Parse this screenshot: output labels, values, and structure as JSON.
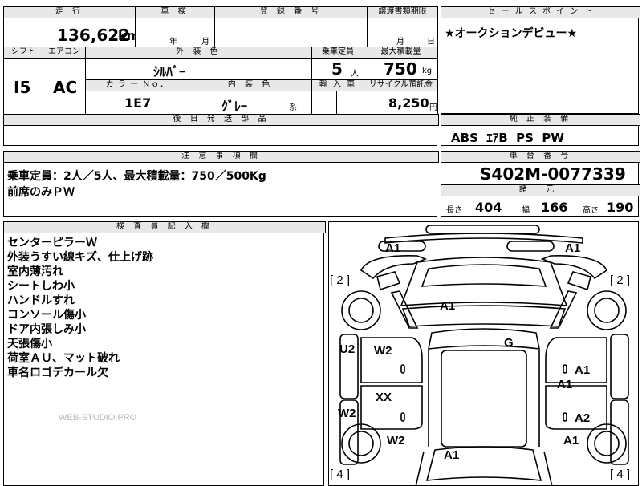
{
  "header_row": {
    "mileage_label": "走 行",
    "inspection_label": "車 検",
    "registration_label": "登 録 番 号",
    "transfer_label": "譲渡書類期限",
    "mileage_value": "136,622",
    "mileage_unit": "km",
    "year_label": "年",
    "month_label": "月",
    "transfer_month": "月",
    "transfer_day": "日"
  },
  "spec_row": {
    "shift_label": "シフト",
    "ac_label": "エアコン",
    "exterior_label": "外 装 色",
    "capacity_label": "乗車定員",
    "max_load_label": "最大積載量",
    "shift_value": "I5",
    "ac_value": "AC",
    "exterior_value": "ｼﾙﾊﾞｰ",
    "capacity_value": "5",
    "capacity_unit": "人",
    "max_load_value": "750",
    "max_load_unit": "kg",
    "color_no_label": "カ ラ ー Ｎｏ．",
    "interior_label": "内 装 色",
    "import_label": "輸 入 車",
    "recycle_label": "リサイクル預託金",
    "color_no_value": "1E7",
    "interior_value": "ｸﾞﾚｰ",
    "interior_suffix": "系",
    "recycle_value": "8,250",
    "recycle_unit": "円"
  },
  "delivery_label": "後 日 発 送 部 品",
  "sales_point": {
    "label": "セ ー ル ス ポ イ ン ト",
    "text": "★オークションデビュー★"
  },
  "equipment": {
    "label": "純 正 装 備",
    "text": "ABS  ｴｱB  PS  PW"
  },
  "cautions": {
    "label": "注 意 事 項 欄",
    "line1": "乗車定員：2人／5人、最大積載量：750／500Kg",
    "line2": "前席のみＰＷ"
  },
  "chassis": {
    "label": "車 台 番 号",
    "value": "S402M-0077339",
    "dims_label": "諸 元",
    "length_label": "長さ",
    "length_value": "404",
    "width_label": "幅",
    "width_value": "166",
    "height_label": "高さ",
    "height_value": "190"
  },
  "inspector": {
    "label": "検 査 員 記 入 欄",
    "notes": [
      "センターピラーＷ",
      "外装うすい線キズ、仕上げ跡",
      "室内薄汚れ",
      "シートしわ小",
      "ハンドルすれ",
      "コンソール傷小",
      "ドア内張しみ小",
      "天張傷小",
      "荷室ＡＵ、マット破れ",
      "車名ロゴデカール欠"
    ]
  },
  "watermark": "WEB-STUDIO.PRO",
  "diagram": {
    "marks": {
      "front_left": "A1",
      "front_right": "A1",
      "hood": "A1",
      "roof": "G",
      "left_pillar": "U2",
      "front_door_left": "W2",
      "rear_door_left": "XX",
      "left_lower": "W2",
      "rear_left": "W2",
      "right_door_1": "A1",
      "right_door_2": "A1",
      "right_door_3": "A2",
      "right_rear": "A1",
      "rear": "A1"
    },
    "brackets": {
      "left_front": "[ 2 ]",
      "right_front": "[ 2 ]",
      "left_rear": "[ 4 ]",
      "right_rear": "[ 4 ]"
    }
  }
}
